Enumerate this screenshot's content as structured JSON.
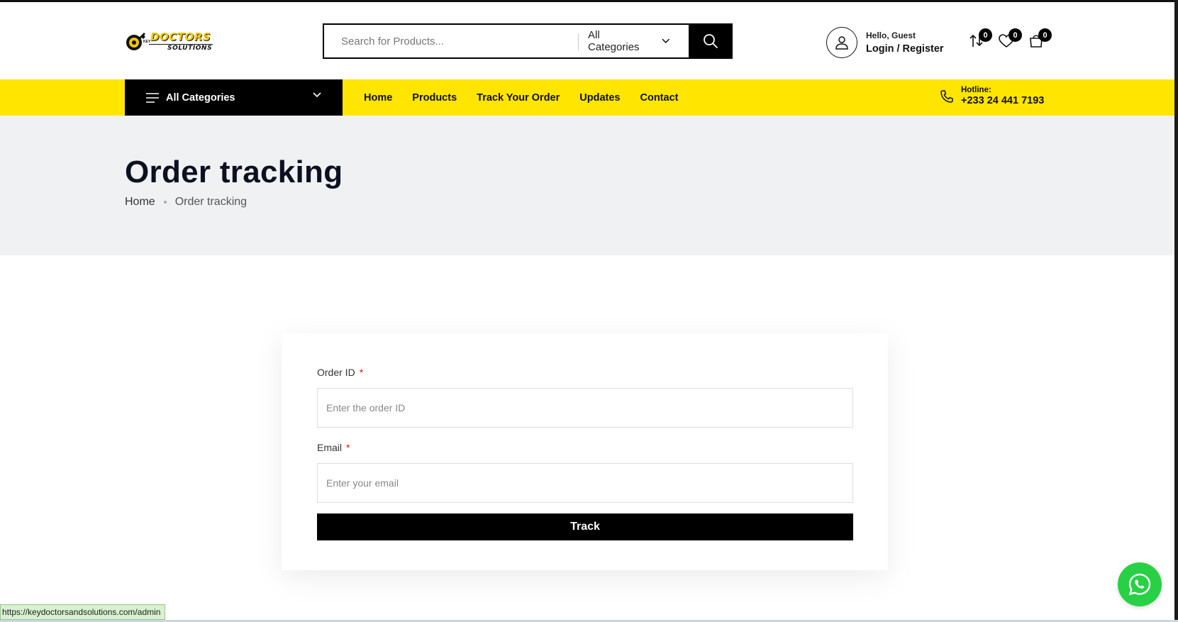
{
  "logo": {
    "line1": "DOCTORS",
    "line2": "SOLUTIONS",
    "small": "KEY"
  },
  "search": {
    "placeholder": "Search for Products...",
    "category": "All Categories"
  },
  "account": {
    "greeting": "Hello, Guest",
    "login": "Login / Register"
  },
  "header_icons": {
    "compare_count": "0",
    "wishlist_count": "0",
    "cart_count": "0"
  },
  "nav": {
    "all_categories": "All Categories",
    "links": [
      "Home",
      "Products",
      "Track Your Order",
      "Updates",
      "Contact"
    ],
    "hotline_label": "Hotline:",
    "hotline_number": "+233 24 441 7193"
  },
  "page": {
    "title": "Order tracking",
    "breadcrumb": [
      "Home",
      "Order tracking"
    ]
  },
  "form": {
    "order_id_label": "Order ID",
    "order_id_placeholder": "Enter the order ID",
    "email_label": "Email",
    "email_placeholder": "Enter your email",
    "required_mark": "*",
    "submit": "Track"
  },
  "status_bar": {
    "url": "https://keydoctorsandsolutions.com/admin"
  },
  "colors": {
    "accent_yellow": "#ffe500",
    "black": "#000000",
    "page_header_bg": "#f0f1f3",
    "whatsapp_green": "#28d045",
    "required_red": "#e11111"
  }
}
